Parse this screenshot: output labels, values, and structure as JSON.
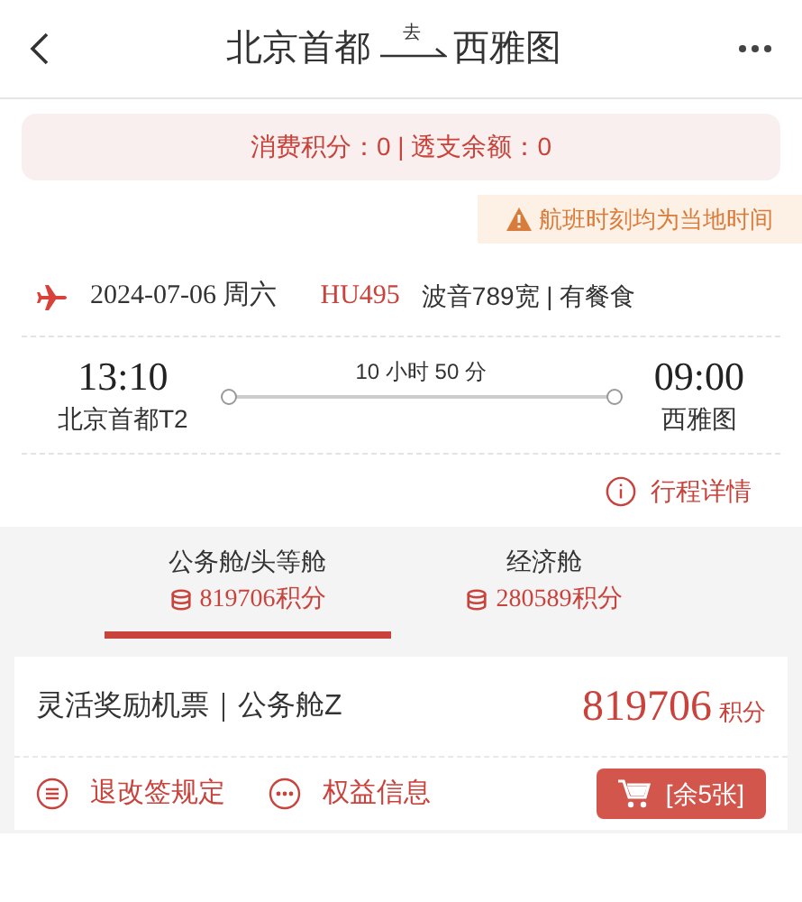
{
  "header": {
    "origin": "北京首都",
    "direction": "去",
    "destination": "西雅图"
  },
  "points_bar": {
    "text": "消费积分：0 | 透支余额：0"
  },
  "notice": {
    "text": "航班时刻均为当地时间"
  },
  "flight": {
    "date": "2024-07-06 周六",
    "flight_no": "HU495",
    "aircraft": "波音789宽 | 有餐食",
    "depart_time": "13:10",
    "depart_airport": "北京首都T2",
    "duration": "10 小时 50 分",
    "arrive_time": "09:00",
    "arrive_airport": "西雅图",
    "details_link": "行程详情"
  },
  "tabs": [
    {
      "label": "公务舱/头等舱",
      "points": "819706积分",
      "selected": true
    },
    {
      "label": "经济舱",
      "points": "280589积分",
      "selected": false
    }
  ],
  "fare": {
    "name": "灵活奖励机票｜公务舱Z",
    "price": "819706",
    "unit": "积分",
    "rules": "退改签规定",
    "benefits": "权益信息",
    "book": "[余5张]"
  }
}
